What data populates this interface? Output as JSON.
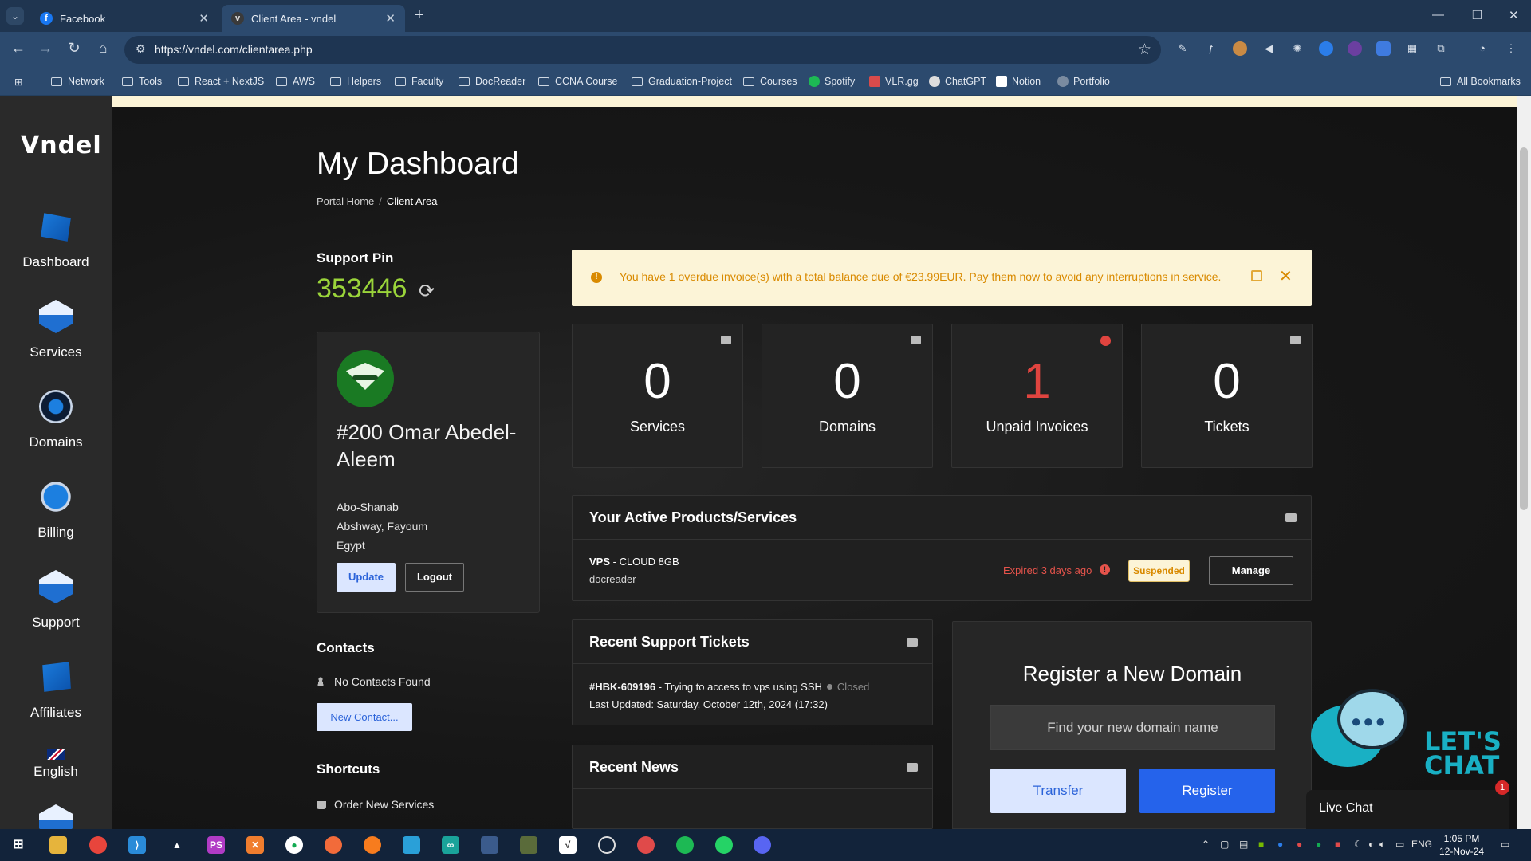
{
  "browser": {
    "tabs": [
      {
        "title": "Facebook",
        "favicon": "facebook-icon"
      },
      {
        "title": "Client Area - vndel",
        "favicon": "vndel-icon"
      }
    ],
    "url": "https://vndel.com/clientarea.php",
    "bookmarks": [
      "Network",
      "Tools",
      "React + NextJS",
      "AWS",
      "Helpers",
      "Faculty",
      "DocReader",
      "CCNA Course",
      "Graduation-Project",
      "Courses",
      "Spotify",
      "VLR.gg",
      "ChatGPT",
      "Notion",
      "Portfolio"
    ],
    "all_bookmarks": "All Bookmarks"
  },
  "sidebar": {
    "logo": "Vndel",
    "items": [
      {
        "label": "Dashboard",
        "icon": "dashboard-icon"
      },
      {
        "label": "Services",
        "icon": "services-icon"
      },
      {
        "label": "Domains",
        "icon": "domains-icon"
      },
      {
        "label": "Billing",
        "icon": "billing-icon"
      },
      {
        "label": "Support",
        "icon": "support-icon"
      },
      {
        "label": "Affiliates",
        "icon": "affiliates-icon"
      },
      {
        "label": "English",
        "icon": "uk-flag-icon"
      }
    ]
  },
  "header": {
    "title": "My Dashboard",
    "breadcrumb": [
      "Portal Home",
      "Client Area"
    ]
  },
  "support_pin": {
    "title": "Support Pin",
    "value": "353446"
  },
  "profile": {
    "name": "#200 Omar Abedel-Aleem",
    "address": [
      "Abo-Shanab",
      "Abshway, Fayoum",
      "Egypt"
    ],
    "update_label": "Update",
    "logout_label": "Logout"
  },
  "contacts": {
    "title": "Contacts",
    "empty": "No Contacts Found",
    "new_label": "New Contact..."
  },
  "shortcuts": {
    "title": "Shortcuts",
    "items": [
      "Order New Services"
    ]
  },
  "alert": {
    "text": "You have 1 overdue invoice(s) with a total balance due of €23.99EUR. Pay them now to avoid any interruptions in service."
  },
  "stats": [
    {
      "value": "0",
      "label": "Services"
    },
    {
      "value": "0",
      "label": "Domains"
    },
    {
      "value": "1",
      "label": "Unpaid Invoices"
    },
    {
      "value": "0",
      "label": "Tickets"
    }
  ],
  "active_products": {
    "title": "Your Active Products/Services",
    "items": [
      {
        "type": "VPS",
        "name": " - CLOUD 8GB",
        "domain": "docreader",
        "expiry": "Expired 3 days ago",
        "status": "Suspended",
        "action": "Manage"
      }
    ]
  },
  "tickets": {
    "title": "Recent Support Tickets",
    "items": [
      {
        "id": "#HBK-609196",
        "subject": " - Trying to access to vps using SSH",
        "status": "Closed",
        "updated": "Last Updated: Saturday, October 12th, 2024 (17:32)"
      }
    ]
  },
  "news": {
    "title": "Recent News"
  },
  "register_domain": {
    "title": "Register a New Domain",
    "placeholder": "Find your new domain name",
    "transfer_label": "Transfer",
    "register_label": "Register"
  },
  "chat": {
    "graphic_text": "LET'S CHAT",
    "label": "Live Chat",
    "badge": "1"
  },
  "taskbar": {
    "language": "ENG",
    "time": "1:05 PM",
    "date": "12-Nov-24"
  },
  "colors": {
    "accent": "#2563eb",
    "pin": "#9ad43a",
    "danger": "#e0443f",
    "warning": "#d98a00"
  }
}
